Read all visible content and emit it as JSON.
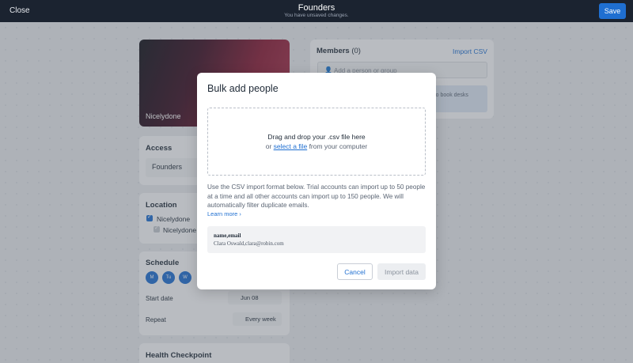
{
  "topbar": {
    "close_label": "Close",
    "title": "Founders",
    "subtitle": "You have unsaved changes.",
    "save_label": "Save"
  },
  "cover": {
    "name": "Nicelydone"
  },
  "access": {
    "title": "Access",
    "value": "Founders"
  },
  "location": {
    "title": "Location",
    "items": [
      {
        "label": "Nicelydone",
        "checked": true
      },
      {
        "label": "Nicelydone",
        "checked": true
      }
    ]
  },
  "schedule": {
    "title": "Schedule",
    "days": [
      "M",
      "Tu",
      "W"
    ],
    "start_date_label": "Start date",
    "start_date_value": "Jun 08",
    "repeat_label": "Repeat",
    "repeat_value": "Every week"
  },
  "health": {
    "title": "Health Checkpoint"
  },
  "members": {
    "title": "Members",
    "count": "(0)",
    "import_csv": "Import CSV",
    "placeholder": "Add a person or group",
    "info_text": "ed to book desks"
  },
  "modal": {
    "title": "Bulk add people",
    "drop_line1": "Drag and drop your .csv file here",
    "drop_or": "or",
    "drop_link": "select a file",
    "drop_suffix": "from your computer",
    "description": "Use the CSV import format below. Trial accounts can import up to 50 people at a time and all other accounts can import up to 150 people. We will automatically filter duplicate emails.",
    "learn_more": "Learn more ›",
    "sample_header": "name,email",
    "sample_row": "Clara Oswald,clara@robin.com",
    "cancel_label": "Cancel",
    "import_label": "Import data"
  },
  "colors": {
    "accent": "#1f6fd1",
    "topbar": "#1b2330",
    "page_bg": "#e9ebee"
  }
}
